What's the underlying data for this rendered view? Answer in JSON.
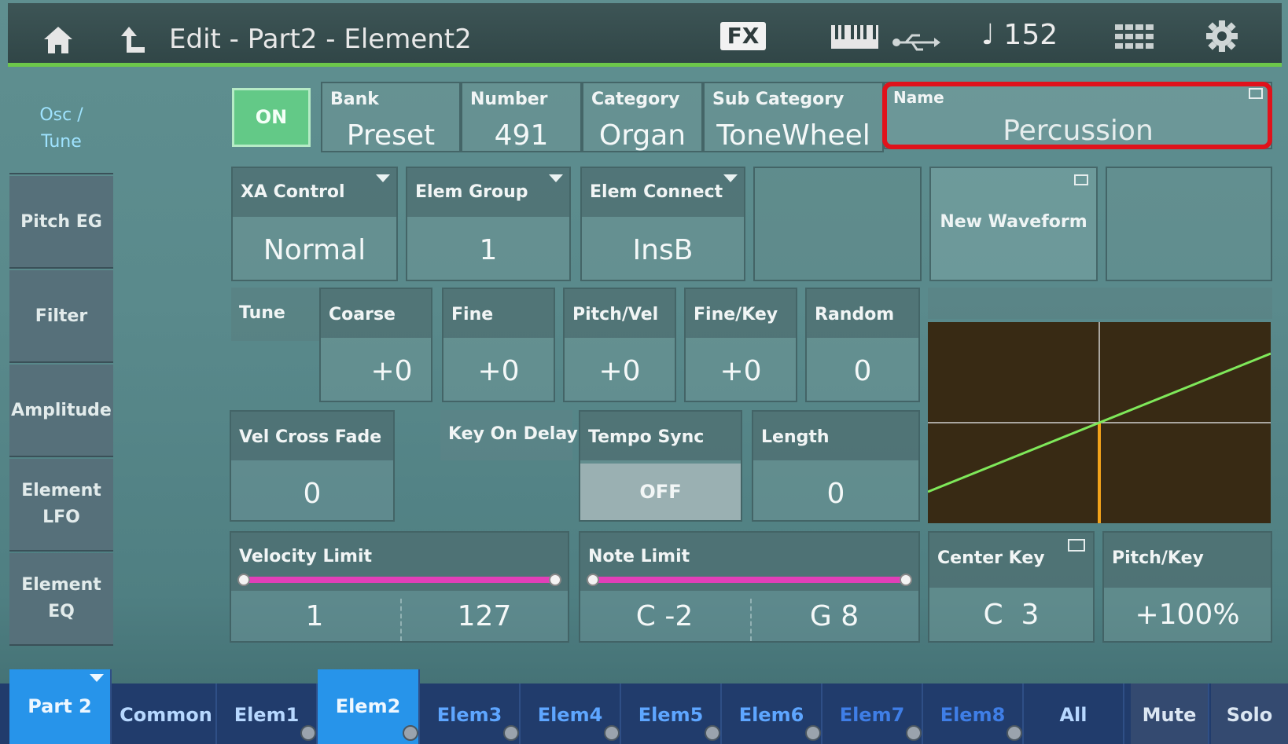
{
  "header": {
    "title": "Edit - Part2 - Element2",
    "fx_label": "FX",
    "tempo": "♩ 152",
    "icons": [
      "home-icon",
      "back-icon",
      "keyboard-icon",
      "usb-icon",
      "grid-icon",
      "gear-icon"
    ]
  },
  "sidebar": {
    "items": [
      {
        "label": "Osc /\nTune",
        "active": true
      },
      {
        "label": "Pitch EG"
      },
      {
        "label": "Filter"
      },
      {
        "label": "Amplitude"
      },
      {
        "label": "Element\nLFO"
      },
      {
        "label": "Element\nEQ"
      }
    ]
  },
  "row1": {
    "on_label": "ON",
    "bank": {
      "label": "Bank",
      "value": "Preset"
    },
    "number": {
      "label": "Number",
      "value": "491"
    },
    "category": {
      "label": "Category",
      "value": "Organ"
    },
    "sub_category": {
      "label": "Sub Category",
      "value": "ToneWheel"
    },
    "name": {
      "label": "Name",
      "value": "Percussion"
    }
  },
  "row2": {
    "xa_control": {
      "label": "XA Control",
      "value": "Normal"
    },
    "elem_group": {
      "label": "Elem Group",
      "value": "1"
    },
    "elem_connect": {
      "label": "Elem Connect",
      "value": "InsB"
    },
    "new_waveform": "New Waveform"
  },
  "row3": {
    "tune": "Tune",
    "coarse": {
      "label": "Coarse",
      "value": "+0"
    },
    "fine": {
      "label": "Fine",
      "value": "+0"
    },
    "pitch_vel": {
      "label": "Pitch/Vel",
      "value": "+0"
    },
    "fine_key": {
      "label": "Fine/Key",
      "value": "+0"
    },
    "random": {
      "label": "Random",
      "value": "0"
    }
  },
  "row4": {
    "vel_cross_fade": {
      "label": "Vel Cross Fade",
      "value": "0"
    },
    "key_on_delay": "Key On Delay",
    "tempo_sync": {
      "label": "Tempo Sync",
      "value": "OFF"
    },
    "length": {
      "label": "Length",
      "value": "0"
    }
  },
  "row5": {
    "velocity_limit": {
      "label": "Velocity Limit",
      "low": "1",
      "high": "127"
    },
    "note_limit": {
      "label": "Note Limit",
      "low": "C -2",
      "high": "G 8"
    },
    "center_key": {
      "label": "Center Key",
      "value": "C  3"
    },
    "pitch_key": {
      "label": "Pitch/Key",
      "value": "+100%"
    }
  },
  "bottom_tabs": [
    "Part 2",
    "Common",
    "Elem1",
    "Elem2",
    "Elem3",
    "Elem4",
    "Elem5",
    "Elem6",
    "Elem7",
    "Elem8",
    "All",
    "Mute",
    "Solo"
  ],
  "selected_tab": "Elem2",
  "colors": {
    "accent_green": "#6dc74a",
    "on_green": "#63c987",
    "slider_pink": "#e13fb8",
    "highlight_red": "#e0121b",
    "tab_blue": "#2794ea"
  }
}
